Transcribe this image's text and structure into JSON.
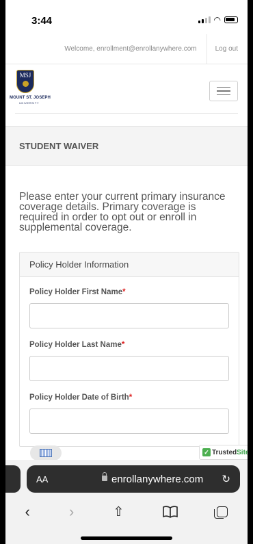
{
  "status_bar": {
    "time": "3:44"
  },
  "account_bar": {
    "welcome": "Welcome, enrollment@enrollanywhere.com",
    "logout": "Log out"
  },
  "brand": {
    "shield_text": "MSJ",
    "name": "MOUNT ST. JOSEPH",
    "subname": "UNIVERSITY"
  },
  "page": {
    "title": "STUDENT WAIVER",
    "intro": "Please enter your current primary insurance coverage details. Primary coverage is required in order to opt out or enroll in supplemental coverage."
  },
  "form": {
    "section_title": "Policy Holder Information",
    "required_mark": "*",
    "fields": [
      {
        "label": "Policy Holder First Name",
        "value": ""
      },
      {
        "label": "Policy Holder Last Name",
        "value": ""
      },
      {
        "label": "Policy Holder Date of Birth",
        "value": ""
      }
    ]
  },
  "badge": {
    "trusted": "Trusted",
    "site": "Site"
  },
  "browser": {
    "aa": "AA",
    "url": "enrollanywhere.com",
    "reload_icon": "↻",
    "back_icon": "‹",
    "forward_icon": "›",
    "share_icon": "⇧",
    "bookmarks_icon": "book-icon"
  }
}
